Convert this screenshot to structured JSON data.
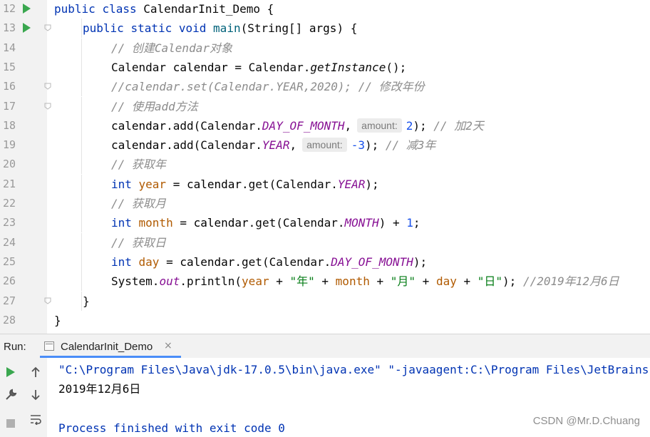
{
  "editor": {
    "lines": [
      {
        "num": "12",
        "run": true,
        "segments": [
          [
            "kw",
            "public "
          ],
          [
            "kw",
            "class "
          ],
          [
            "punc",
            "CalendarInit_Demo "
          ],
          [
            "punc",
            "{"
          ]
        ]
      },
      {
        "num": "13",
        "run": true,
        "segments": [
          [
            "kw",
            "public "
          ],
          [
            "kw",
            "static "
          ],
          [
            "kw",
            "void "
          ],
          [
            "fn",
            "main"
          ],
          [
            "punc",
            "(String[] "
          ],
          [
            "loc",
            "args"
          ],
          [
            "punc",
            ") {"
          ]
        ]
      },
      {
        "num": "14",
        "segments": [
          [
            "cm",
            "// 创建Calendar对象"
          ]
        ]
      },
      {
        "num": "15",
        "segments": [
          [
            "punc",
            "Calendar "
          ],
          [
            "lvar",
            "calendar"
          ],
          [
            "punc",
            " = Calendar."
          ],
          [
            "smethod",
            "getInstance"
          ],
          [
            "punc",
            "();"
          ]
        ]
      },
      {
        "num": "16",
        "segments": [
          [
            "cm",
            "//calendar.set(Calendar.YEAR,2020); // 修改年份"
          ]
        ]
      },
      {
        "num": "17",
        "segments": [
          [
            "cm",
            "// 使用add方法"
          ]
        ]
      },
      {
        "num": "18",
        "segments": [
          [
            "lvar",
            "calendar"
          ],
          [
            "punc",
            ".add(Calendar."
          ],
          [
            "cfield",
            "DAY_OF_MONTH"
          ],
          [
            "punc",
            ","
          ],
          [
            "hint",
            "amount:"
          ],
          [
            "num",
            "2"
          ],
          [
            "punc",
            "); "
          ],
          [
            "cm",
            "// 加2天"
          ]
        ]
      },
      {
        "num": "19",
        "segments": [
          [
            "lvar",
            "calendar"
          ],
          [
            "punc",
            ".add(Calendar."
          ],
          [
            "cfield",
            "YEAR"
          ],
          [
            "punc",
            ","
          ],
          [
            "hint",
            "amount:"
          ],
          [
            "num",
            "-3"
          ],
          [
            "punc",
            "); "
          ],
          [
            "cm",
            "// 减3年"
          ]
        ]
      },
      {
        "num": "20",
        "segments": [
          [
            "cm",
            "// 获取年"
          ]
        ]
      },
      {
        "num": "21",
        "segments": [
          [
            "kw",
            "int "
          ],
          [
            "mvar",
            "year"
          ],
          [
            "punc",
            " = "
          ],
          [
            "lvar",
            "calendar"
          ],
          [
            "punc",
            ".get(Calendar."
          ],
          [
            "cfield",
            "YEAR"
          ],
          [
            "punc",
            ");"
          ]
        ]
      },
      {
        "num": "22",
        "segments": [
          [
            "cm",
            "// 获取月"
          ]
        ]
      },
      {
        "num": "23",
        "segments": [
          [
            "kw",
            "int "
          ],
          [
            "mvar",
            "month"
          ],
          [
            "punc",
            " = "
          ],
          [
            "lvar",
            "calendar"
          ],
          [
            "punc",
            ".get(Calendar."
          ],
          [
            "cfield",
            "MONTH"
          ],
          [
            "punc",
            ") + "
          ],
          [
            "num",
            "1"
          ],
          [
            "punc",
            ";"
          ]
        ]
      },
      {
        "num": "24",
        "segments": [
          [
            "cm",
            "// 获取日"
          ]
        ]
      },
      {
        "num": "25",
        "segments": [
          [
            "kw",
            "int "
          ],
          [
            "mvar",
            "day"
          ],
          [
            "punc",
            " = "
          ],
          [
            "lvar",
            "calendar"
          ],
          [
            "punc",
            ".get(Calendar."
          ],
          [
            "cfield",
            "DAY_OF_MONTH"
          ],
          [
            "punc",
            ");"
          ]
        ]
      },
      {
        "num": "26",
        "segments": [
          [
            "punc",
            "System."
          ],
          [
            "cfield",
            "out"
          ],
          [
            "punc",
            ".println("
          ],
          [
            "mvar",
            "year"
          ],
          [
            "punc",
            " + "
          ],
          [
            "str",
            "\"年\""
          ],
          [
            "punc",
            " + "
          ],
          [
            "mvar",
            "month"
          ],
          [
            "punc",
            " + "
          ],
          [
            "str",
            "\"月\""
          ],
          [
            "punc",
            " + "
          ],
          [
            "mvar",
            "day"
          ],
          [
            "punc",
            " + "
          ],
          [
            "str",
            "\"日\""
          ],
          [
            "punc",
            "); "
          ],
          [
            "cm",
            "//2019年12月6日"
          ]
        ]
      },
      {
        "num": "27",
        "segments": [
          [
            "punc",
            "}"
          ]
        ]
      },
      {
        "num": "28",
        "segments": [
          [
            "punc",
            "}"
          ]
        ]
      }
    ]
  },
  "run_panel": {
    "label": "Run:",
    "tab_label": "CalendarInit_Demo",
    "tab_close": "×",
    "output": {
      "command": "\"C:\\Program Files\\Java\\jdk-17.0.5\\bin\\java.exe\" \"-javaagent:C:\\Program Files\\JetBrains",
      "result": "2019年12月6日",
      "exit": "Process finished with exit code 0"
    },
    "toolbar_icons": [
      "rerun-icon",
      "arrow-up-icon",
      "wrench-icon",
      "arrow-down-icon",
      "stop-icon",
      "soft-wrap-icon"
    ]
  },
  "watermark": "CSDN @Mr.D.Chuang",
  "colors": {
    "keyword": "#0033b3",
    "string": "#067d17",
    "comment": "#8c8c8c",
    "number": "#1750eb",
    "field": "#871094",
    "run_green": "#3aa74f",
    "tab_underline": "#4a8df8"
  }
}
